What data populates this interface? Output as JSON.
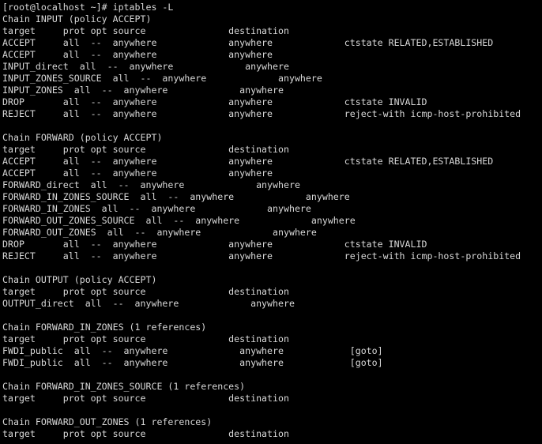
{
  "terminal": {
    "lines": [
      "[root@localhost ~]# iptables -L",
      "Chain INPUT (policy ACCEPT)",
      "target     prot opt source               destination",
      "ACCEPT     all  --  anywhere             anywhere             ctstate RELATED,ESTABLISHED",
      "ACCEPT     all  --  anywhere             anywhere",
      "INPUT_direct  all  --  anywhere             anywhere",
      "INPUT_ZONES_SOURCE  all  --  anywhere             anywhere",
      "INPUT_ZONES  all  --  anywhere             anywhere",
      "DROP       all  --  anywhere             anywhere             ctstate INVALID",
      "REJECT     all  --  anywhere             anywhere             reject-with icmp-host-prohibited",
      "",
      "Chain FORWARD (policy ACCEPT)",
      "target     prot opt source               destination",
      "ACCEPT     all  --  anywhere             anywhere             ctstate RELATED,ESTABLISHED",
      "ACCEPT     all  --  anywhere             anywhere",
      "FORWARD_direct  all  --  anywhere             anywhere",
      "FORWARD_IN_ZONES_SOURCE  all  --  anywhere             anywhere",
      "FORWARD_IN_ZONES  all  --  anywhere             anywhere",
      "FORWARD_OUT_ZONES_SOURCE  all  --  anywhere             anywhere",
      "FORWARD_OUT_ZONES  all  --  anywhere             anywhere",
      "DROP       all  --  anywhere             anywhere             ctstate INVALID",
      "REJECT     all  --  anywhere             anywhere             reject-with icmp-host-prohibited",
      "",
      "Chain OUTPUT (policy ACCEPT)",
      "target     prot opt source               destination",
      "OUTPUT_direct  all  --  anywhere             anywhere",
      "",
      "Chain FORWARD_IN_ZONES (1 references)",
      "target     prot opt source               destination",
      "FWDI_public  all  --  anywhere             anywhere            [goto]",
      "FWDI_public  all  --  anywhere             anywhere            [goto]",
      "",
      "Chain FORWARD_IN_ZONES_SOURCE (1 references)",
      "target     prot opt source               destination",
      "",
      "Chain FORWARD_OUT_ZONES (1 references)",
      "target     prot opt source               destination"
    ]
  }
}
